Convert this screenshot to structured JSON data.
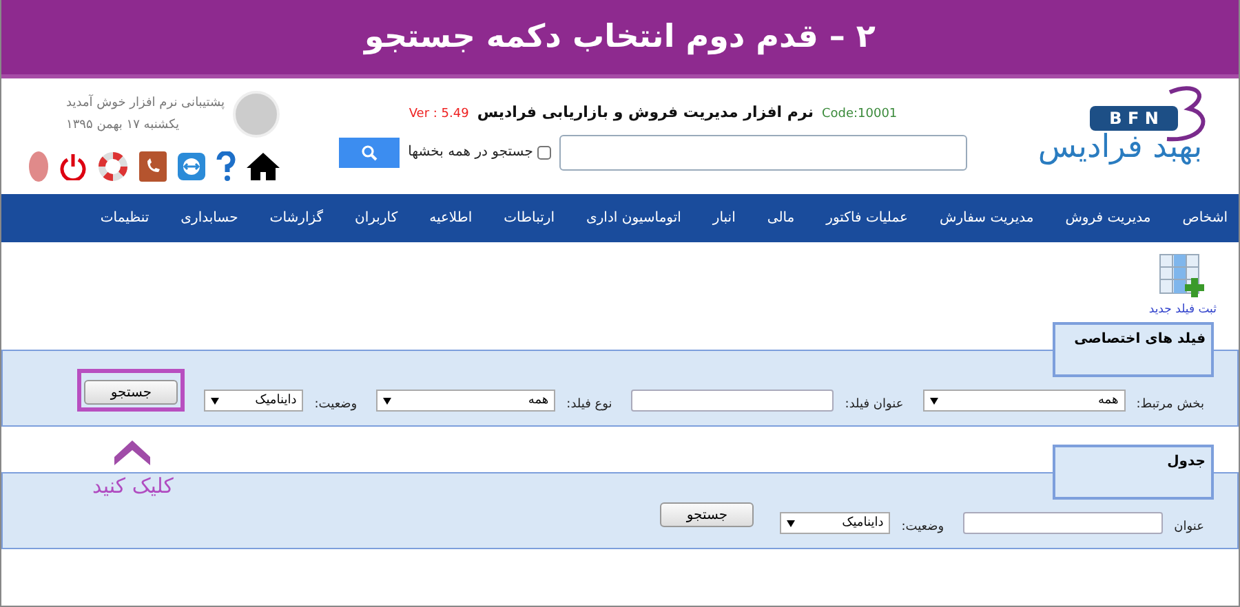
{
  "banner": {
    "title": "۲ – قدم دوم انتخاب دکمه جستجو"
  },
  "header": {
    "logo_mark": "B F N",
    "logo_name": "بهبد فرادیس",
    "code": "Code:10001",
    "app_title": "نرم افزار مدیریت فروش و بازاریابی فرادیس",
    "version": "Ver : 5.49",
    "search_all": {
      "label": "جستجو در همه بخشها",
      "checked": false
    },
    "welcome": "پشتیبانی نرم افزار خوش آمدید",
    "date": "یکشنبه ۱۷ بهمن ۱۳۹۵"
  },
  "nav": [
    "اشخاص",
    "مدیریت فروش",
    "مدیریت سفارش",
    "عملیات فاکتور",
    "مالی",
    "انبار",
    "اتوماسیون اداری",
    "ارتباطات",
    "اطلاعیه",
    "کاربران",
    "گزارشات",
    "حسابداری",
    "تنظیمات"
  ],
  "new_field_link": "ثبت فیلد جدید",
  "panels": [
    {
      "title": "فیلد های اختصاصی",
      "fields": [
        {
          "kind": "select",
          "label": "بخش مرتبط:",
          "value": "همه"
        },
        {
          "kind": "input",
          "label": "عنوان فیلد:"
        },
        {
          "kind": "select",
          "label": "نوع فیلد:",
          "value": "همه"
        },
        {
          "kind": "select",
          "label": "وضعیت:",
          "value": "داینامیک"
        }
      ],
      "button": {
        "label": "جستجو",
        "highlighted": true
      }
    },
    {
      "title": "جدول",
      "fields": [
        {
          "kind": "input",
          "label": "عنوان"
        },
        {
          "kind": "select",
          "label": "وضعیت:",
          "value": "داینامیک"
        }
      ],
      "button": {
        "label": "جستجو",
        "highlighted": false
      }
    }
  ],
  "annotation": "کلیک کنید"
}
